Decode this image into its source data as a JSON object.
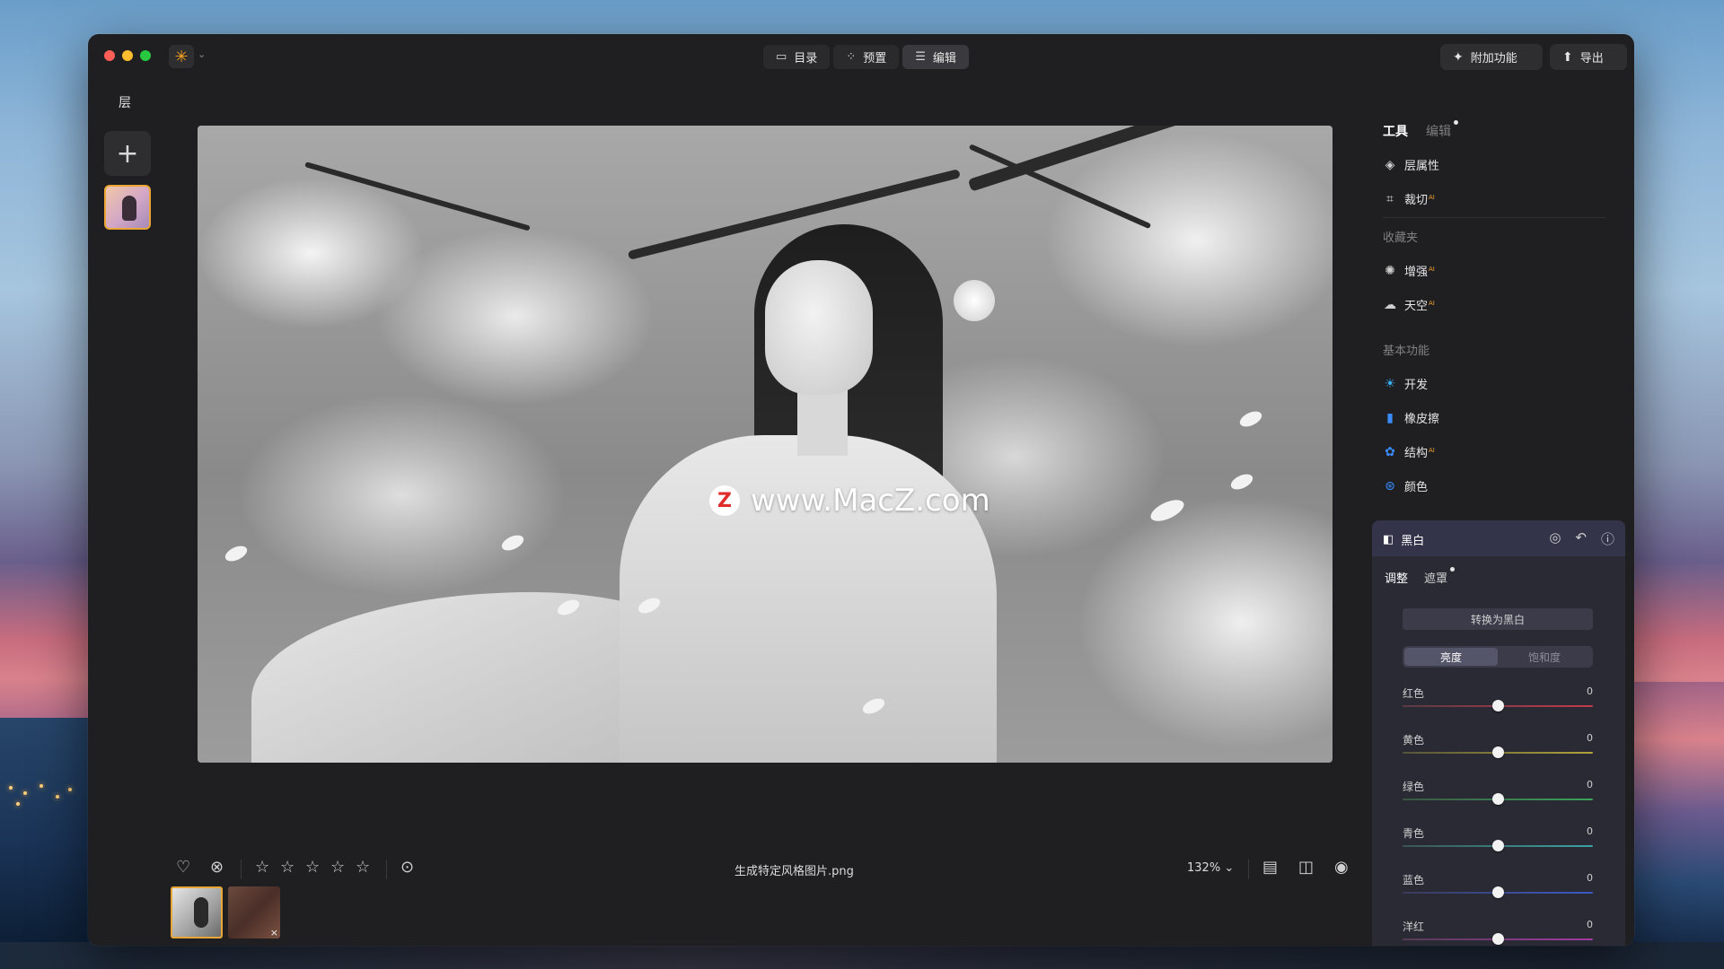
{
  "toolbar": {
    "modes": [
      {
        "label": "目录",
        "icon": "folder-icon"
      },
      {
        "label": "预置",
        "icon": "sparkle-icon"
      },
      {
        "label": "编辑",
        "icon": "sliders-icon"
      }
    ],
    "extras_label": "附加功能",
    "export_label": "导出"
  },
  "layers": {
    "title": "层"
  },
  "canvas": {
    "watermark": "www.MacZ.com",
    "watermark_logo": "Z"
  },
  "bottom": {
    "filename": "生成特定风格图片.png",
    "zoom": "132%",
    "zoom_chevron": "⌄",
    "rating": 0,
    "max_rating": 5
  },
  "rpanel": {
    "tabs": {
      "tools": "工具",
      "edit": "编辑"
    },
    "top_items": [
      {
        "label": "层属性",
        "icon": "layers-icon",
        "ai": false
      },
      {
        "label": "裁切",
        "icon": "crop-icon",
        "ai": true
      }
    ],
    "favorites_label": "收藏夹",
    "favorites": [
      {
        "label": "增强",
        "icon": "enhance-icon",
        "ai": true
      },
      {
        "label": "天空",
        "icon": "cloud-icon",
        "ai": true
      }
    ],
    "basic_label": "基本功能",
    "basic": [
      {
        "label": "开发",
        "icon": "sun-icon",
        "ai": false,
        "color": "#38b6ff"
      },
      {
        "label": "橡皮擦",
        "icon": "eraser-icon",
        "ai": false,
        "color": "#3a8cff"
      },
      {
        "label": "结构",
        "icon": "structure-icon",
        "ai": true,
        "color": "#3a8cff"
      },
      {
        "label": "颜色",
        "icon": "color-icon",
        "ai": false,
        "color": "#3a8cff"
      }
    ],
    "ai_badge": "AI"
  },
  "bw": {
    "title": "黑白",
    "tabs": {
      "adjust": "调整",
      "mask": "遮罩"
    },
    "convert_label": "转换为黑白",
    "segment": {
      "on": "亮度",
      "off": "饱和度"
    },
    "sliders": [
      {
        "label": "红色",
        "value": "0",
        "color": "#c53a4a"
      },
      {
        "label": "黄色",
        "value": "0",
        "color": "#b3a33a"
      },
      {
        "label": "绿色",
        "value": "0",
        "color": "#3aa35a"
      },
      {
        "label": "青色",
        "value": "0",
        "color": "#3aa3a3"
      },
      {
        "label": "蓝色",
        "value": "0",
        "color": "#3a5ac5"
      },
      {
        "label": "洋红",
        "value": "0",
        "color": "#a33aa3"
      }
    ]
  },
  "colors": {
    "accent": "#e9a636",
    "panel_bg": "#2a2a35"
  }
}
